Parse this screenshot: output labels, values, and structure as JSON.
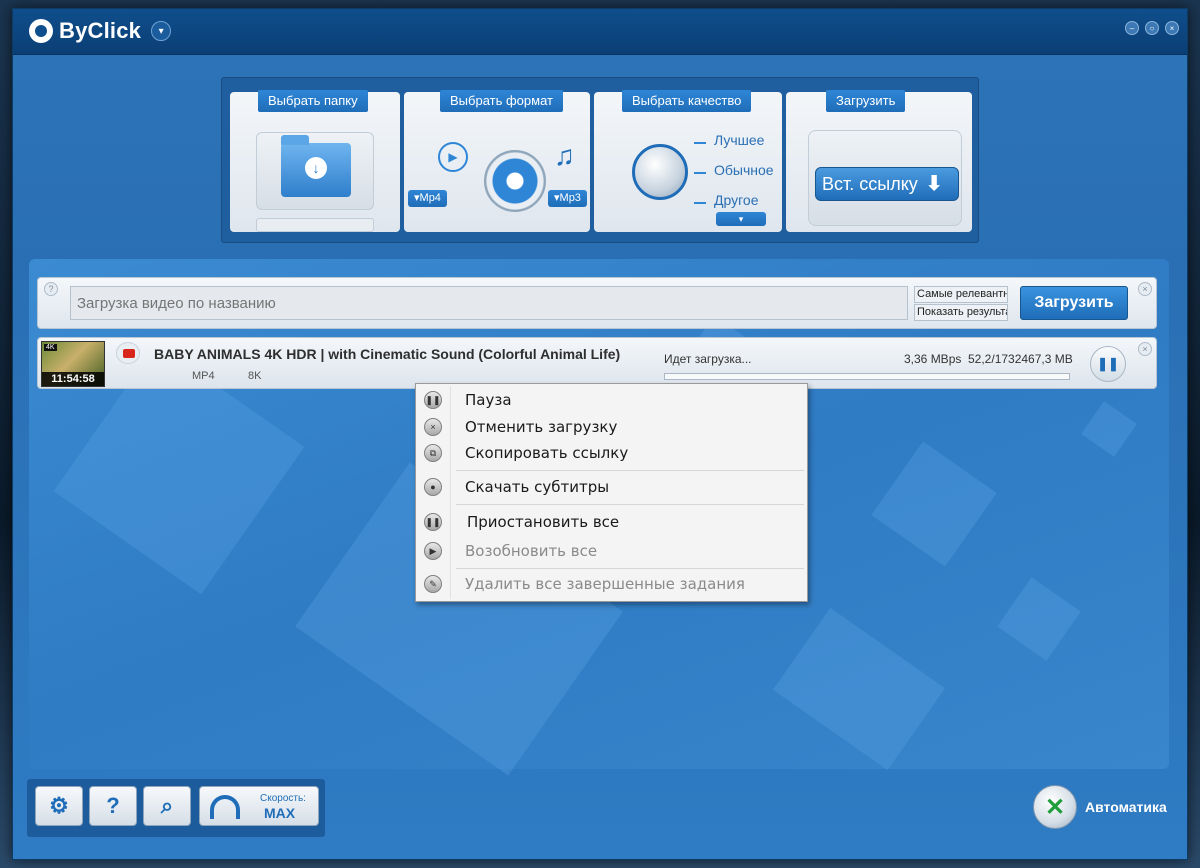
{
  "app": {
    "name": "ByClick"
  },
  "wizard": {
    "folder_label": "Выбрать папку",
    "format_label": "Выбрать формат",
    "quality_label": "Выбрать качество",
    "download_label": "Загрузить",
    "format_video": "Mp4",
    "format_audio": "Mp3",
    "quality_options": [
      "Лучшее",
      "Обычное",
      "Другое"
    ],
    "paste_button": "Вст. ссылку"
  },
  "search": {
    "placeholder": "Загрузка видео по названию",
    "sort_options": [
      "Самые релевантны",
      "Показать результат"
    ],
    "button": "Загрузить"
  },
  "download": {
    "title": "BABY ANIMALS 4K HDR | with Cinematic Sound (Colorful Animal Life)",
    "duration": "11:54:58",
    "format": "MP4",
    "quality": "8K",
    "status": "Идет загрузка...",
    "speed": "3,36 MBps",
    "size": "52,2/1732467,3 MB",
    "progress": 0.0
  },
  "context_menu": {
    "items": [
      {
        "label": "Пауза",
        "icon": "pause-icon",
        "enabled": true
      },
      {
        "label": "Отменить загрузку",
        "icon": "cancel-icon",
        "enabled": true
      },
      {
        "label": "Скопировать ссылку",
        "icon": "copy-icon",
        "enabled": true
      },
      {
        "label": "Скачать субтитры",
        "icon": "subtitles-icon",
        "enabled": true
      },
      {
        "label": "Приостановить все",
        "icon": "pause-all-icon",
        "enabled": true
      },
      {
        "label": "Возобновить все",
        "icon": "resume-all-icon",
        "enabled": false
      },
      {
        "label": "Удалить все завершенные задания",
        "icon": "delete-completed-icon",
        "enabled": false
      }
    ]
  },
  "bottom": {
    "speed_label": "Скорость:",
    "speed_value": "MAX",
    "auto_label": "Автоматика"
  },
  "colors": {
    "accent": "#2f86d6",
    "window": "#2d74b8",
    "titlebar": "#0f4e8c"
  }
}
